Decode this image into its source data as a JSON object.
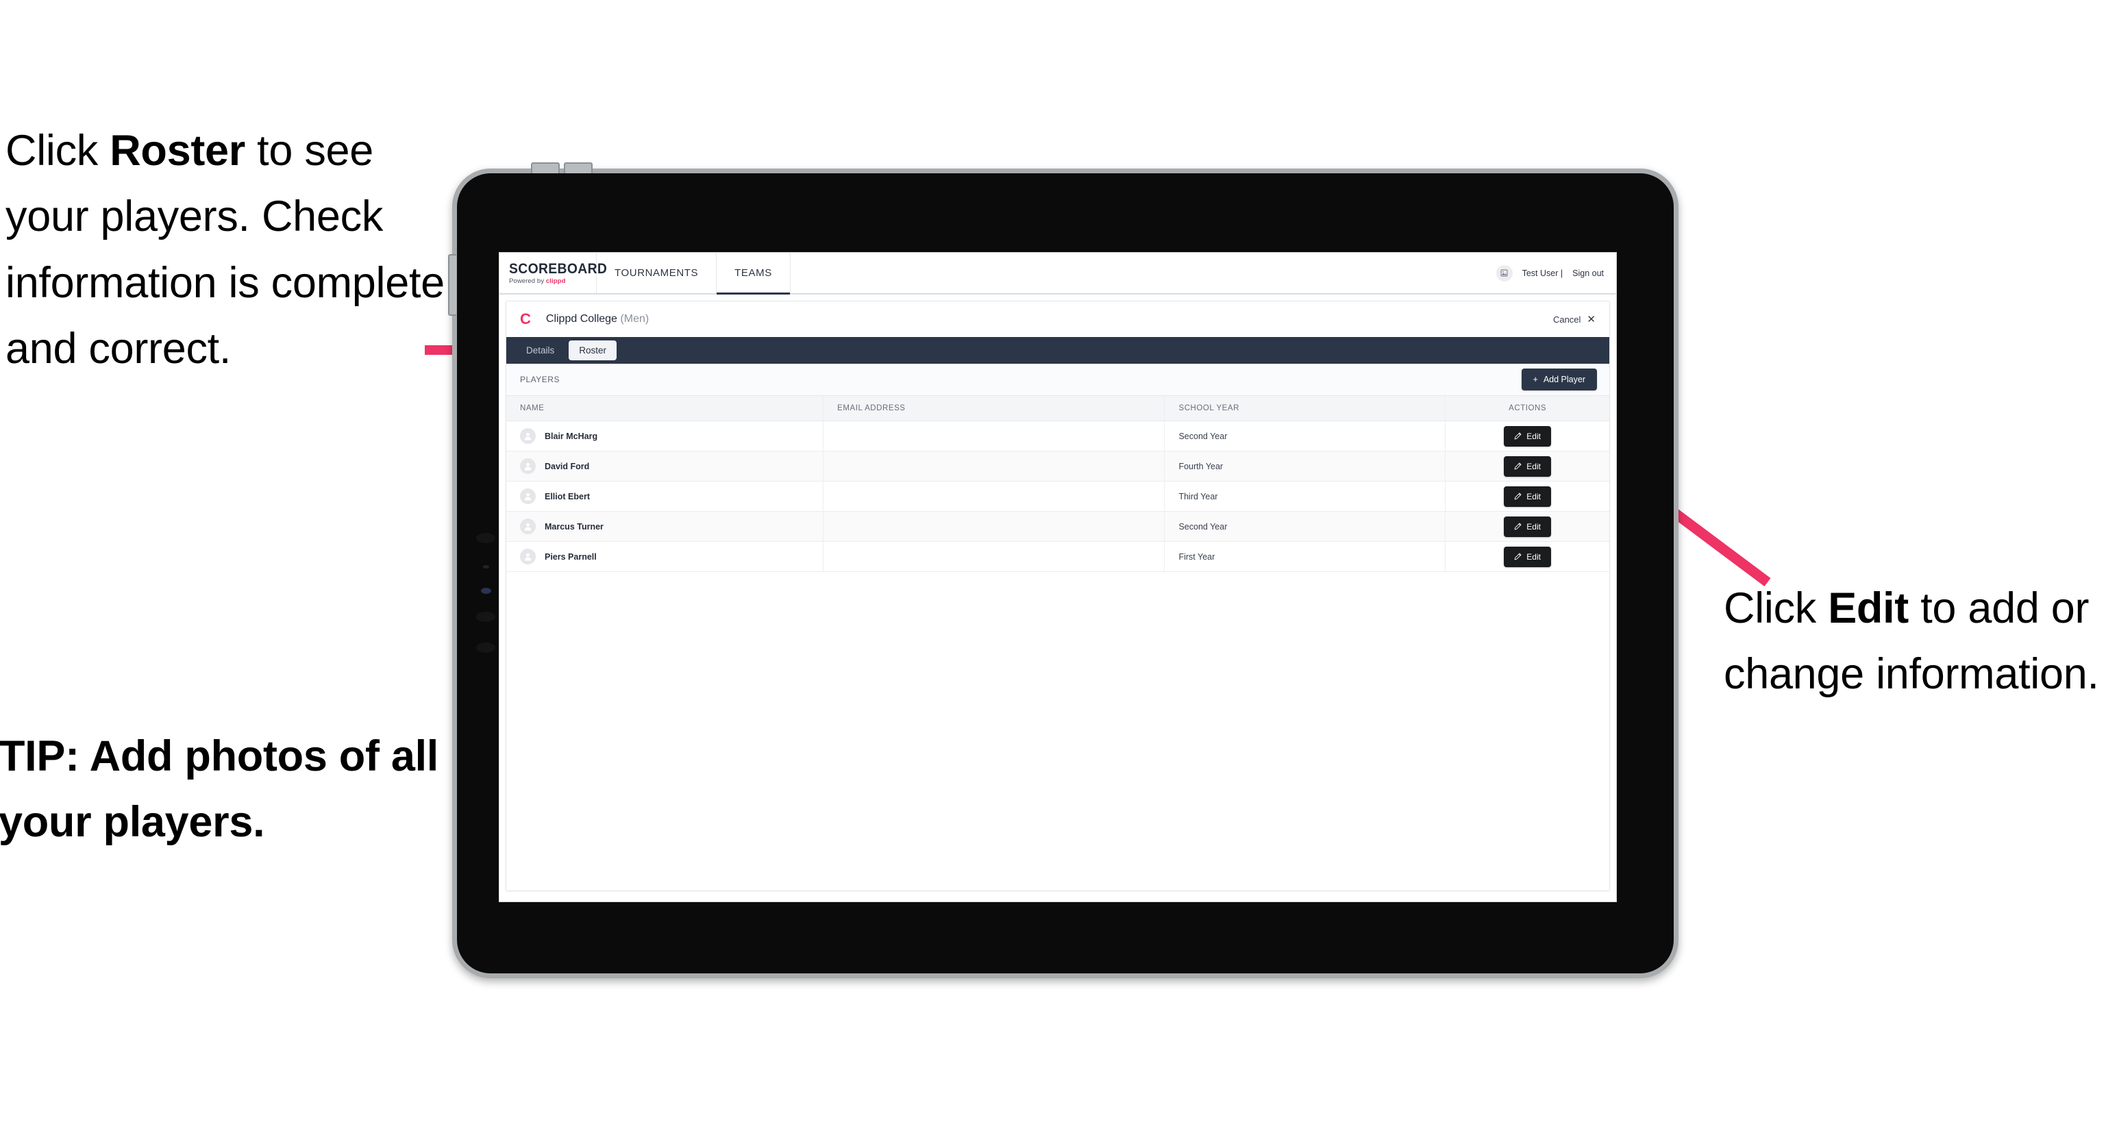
{
  "annotations": {
    "left": {
      "segments": [
        {
          "text": "Click ",
          "bold": false
        },
        {
          "text": "Roster",
          "bold": true
        },
        {
          "text": " to see your players. Check information is complete and correct.",
          "bold": false
        }
      ],
      "plain": "Click Roster to see your players. Check information is complete and correct."
    },
    "tip": {
      "plain": "TIP: Add photos of all your players."
    },
    "right": {
      "segments": [
        {
          "text": "Click ",
          "bold": false
        },
        {
          "text": "Edit",
          "bold": true
        },
        {
          "text": " to add or change information.",
          "bold": false
        }
      ],
      "plain": "Click Edit to add or change information."
    },
    "arrow_color": "#ee3365"
  },
  "app": {
    "logo": {
      "wordmark": "SCOREBOARD",
      "powered_by_prefix": "Powered by ",
      "brand": "clippd"
    },
    "topnav": {
      "tabs": [
        {
          "label": "TOURNAMENTS",
          "active": false
        },
        {
          "label": "TEAMS",
          "active": true
        }
      ],
      "user_name": "Test User |",
      "sign_out": "Sign out",
      "avatar_icon": "user-image-icon"
    },
    "panel": {
      "team_logo_letter": "C",
      "team_name": "Clippd College",
      "team_gender": "(Men)",
      "cancel_label": "Cancel",
      "cancel_icon": "close-icon",
      "subtabs": [
        {
          "label": "Details",
          "active": false
        },
        {
          "label": "Roster",
          "active": true
        }
      ],
      "players_label": "PLAYERS",
      "add_player_label": "Add Player",
      "add_player_icon": "plus-icon"
    },
    "table": {
      "columns": [
        "NAME",
        "EMAIL ADDRESS",
        "SCHOOL YEAR",
        "ACTIONS"
      ],
      "edit_label": "Edit",
      "edit_icon": "pencil-icon",
      "avatar_icon": "person-avatar-icon",
      "rows": [
        {
          "name": "Blair McHarg",
          "email": "",
          "school_year": "Second Year"
        },
        {
          "name": "David Ford",
          "email": "",
          "school_year": "Fourth Year"
        },
        {
          "name": "Elliot Ebert",
          "email": "",
          "school_year": "Third Year"
        },
        {
          "name": "Marcus Turner",
          "email": "",
          "school_year": "Second Year"
        },
        {
          "name": "Piers Parnell",
          "email": "",
          "school_year": "First Year"
        }
      ]
    },
    "colors": {
      "navy": "#2b3648",
      "brand_pink": "#ee3365",
      "edit_black": "#1b1c1e"
    }
  }
}
